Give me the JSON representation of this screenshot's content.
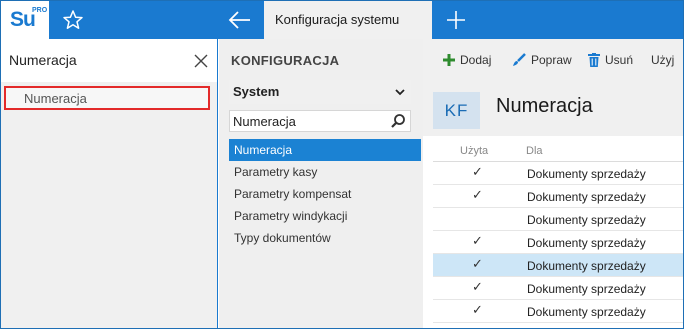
{
  "app": {
    "logo_text": "Su",
    "logo_badge": "PRO",
    "active_tab": "Konfiguracja systemu",
    "accent_color": "#1a7ad0"
  },
  "left_panel": {
    "search_value": "Numeracja",
    "results": [
      "Numeracja"
    ]
  },
  "config_panel": {
    "title": "KONFIGURACJA",
    "selected_group": "System",
    "search_value": "Numeracja",
    "items": [
      {
        "label": "Numeracja",
        "selected": true
      },
      {
        "label": "Parametry kasy",
        "selected": false
      },
      {
        "label": "Parametry kompensat",
        "selected": false
      },
      {
        "label": "Parametry windykacji",
        "selected": false
      },
      {
        "label": "Typy dokumentów",
        "selected": false
      }
    ]
  },
  "toolbar": {
    "add_label": "Dodaj",
    "edit_label": "Popraw",
    "delete_label": "Usuń",
    "use_label": "Użyj"
  },
  "content": {
    "tile_text": "KF",
    "title": "Numeracja",
    "columns": [
      "Użyta",
      "Dla"
    ],
    "rows": [
      {
        "used": "✓",
        "for": "Dokumenty sprzedaży",
        "selected": false
      },
      {
        "used": "✓",
        "for": "Dokumenty sprzedaży",
        "selected": false
      },
      {
        "used": "",
        "for": "Dokumenty sprzedaży",
        "selected": false
      },
      {
        "used": "✓",
        "for": "Dokumenty sprzedaży",
        "selected": false
      },
      {
        "used": "✓",
        "for": "Dokumenty sprzedaży",
        "selected": true
      },
      {
        "used": "✓",
        "for": "Dokumenty sprzedaży",
        "selected": false
      },
      {
        "used": "✓",
        "for": "Dokumenty sprzedaży",
        "selected": false
      }
    ]
  }
}
